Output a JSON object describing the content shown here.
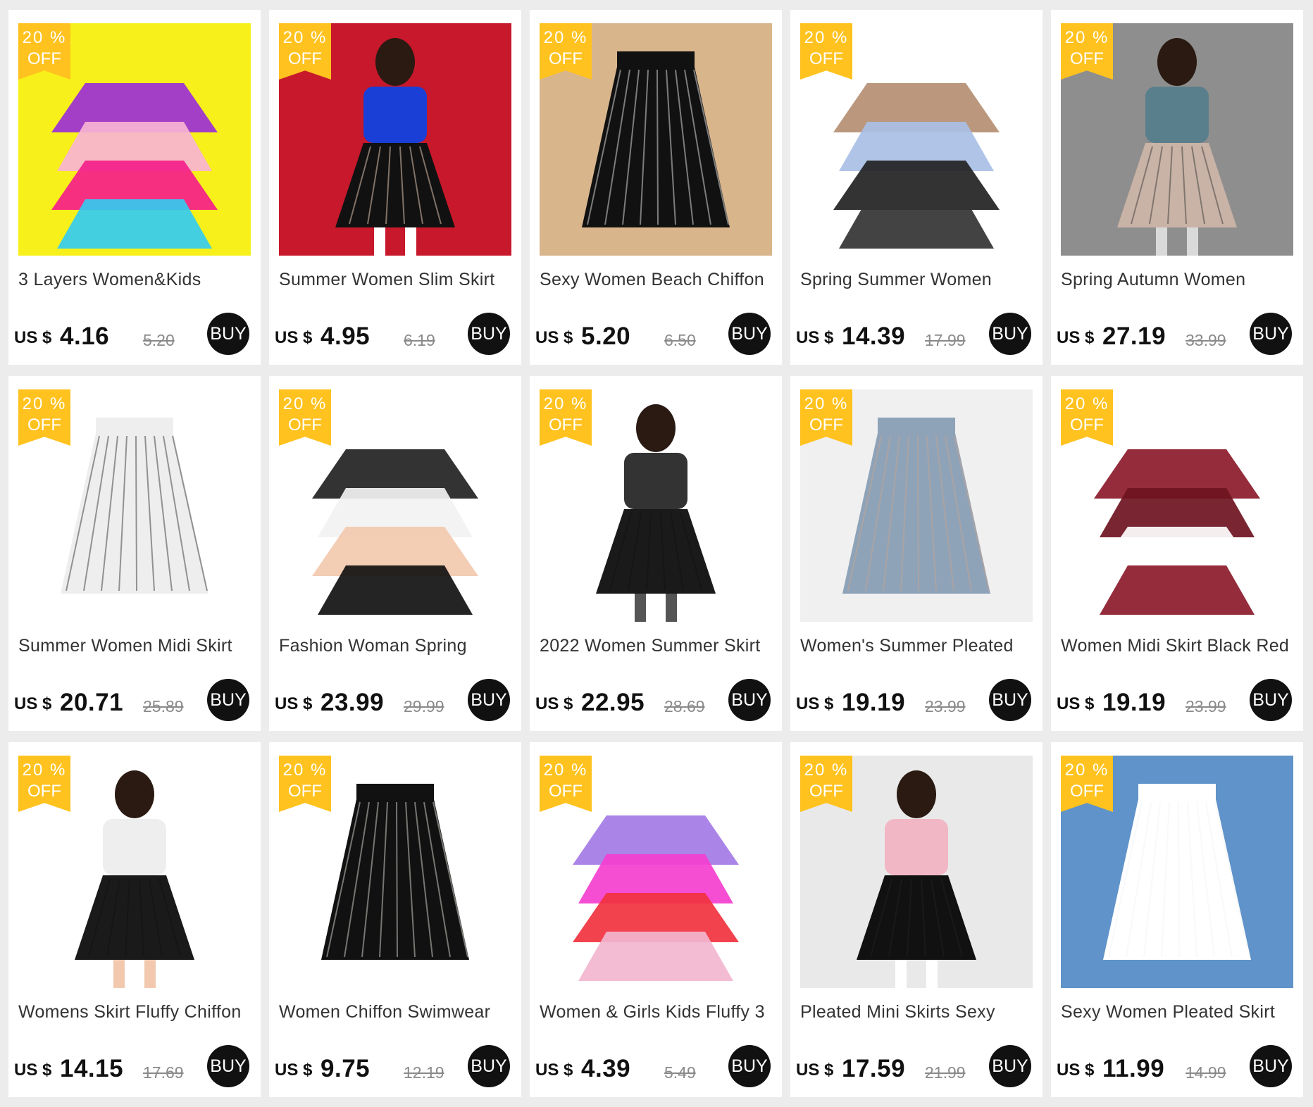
{
  "theme": {
    "badge_color": "#ffc21f",
    "buy_button_color": "#111111",
    "page_background": "#ececec"
  },
  "products": [
    {
      "badge": {
        "percent": "20 %",
        "off": "OFF"
      },
      "image_icon": "tutu-skirt-stack-image",
      "title": "3 Layers Women&Kids",
      "currency": "US $",
      "price": "4.16",
      "old_price": "5.20",
      "buy_label": "BUY",
      "palette": [
        "#f7f01a",
        "#9b2fd6",
        "#f7b3d3",
        "#f51e8a",
        "#33ccf0"
      ]
    },
    {
      "badge": {
        "percent": "20 %",
        "off": "OFF"
      },
      "image_icon": "pencil-skirt-models-image",
      "title": "Summer Women Slim Skirt",
      "currency": "US $",
      "price": "4.95",
      "old_price": "6.19",
      "buy_label": "BUY",
      "palette": [
        "#c8182b",
        "#111111",
        "#1a3fd6",
        "#ffffff",
        "#f1d2bd"
      ]
    },
    {
      "badge": {
        "percent": "20 %",
        "off": "OFF"
      },
      "image_icon": "beach-wrap-skirt-image",
      "title": "Sexy Women Beach Chiffon",
      "currency": "US $",
      "price": "5.20",
      "old_price": "6.50",
      "buy_label": "BUY",
      "palette": [
        "#d9b58c",
        "#111111",
        "#ffffff",
        "#e8e21a",
        "#7a2fbf"
      ]
    },
    {
      "badge": {
        "percent": "20 %",
        "off": "OFF"
      },
      "image_icon": "floral-maxi-skirt-image",
      "title": "Spring Summer Women",
      "currency": "US $",
      "price": "14.39",
      "old_price": "17.99",
      "buy_label": "BUY",
      "palette": [
        "#ffffff",
        "#b58f72",
        "#a9bfe6",
        "#222222",
        "#333333"
      ]
    },
    {
      "badge": {
        "percent": "20 %",
        "off": "OFF"
      },
      "image_icon": "pleated-knit-skirt-image",
      "title": "Spring Autumn Women",
      "currency": "US $",
      "price": "27.19",
      "old_price": "33.99",
      "buy_label": "BUY",
      "palette": [
        "#8e8e8e",
        "#c9b3a6",
        "#5a7f8c",
        "#d9d9d9",
        "#3a3a3a"
      ]
    },
    {
      "badge": {
        "percent": "20 %",
        "off": "OFF"
      },
      "image_icon": "polka-dot-midi-skirt-image",
      "title": "Summer Women Midi Skirt",
      "currency": "US $",
      "price": "20.71",
      "old_price": "25.89",
      "buy_label": "BUY",
      "palette": [
        "#ffffff",
        "#eeeeee",
        "#222222",
        "#f2c9ae",
        "#111111"
      ]
    },
    {
      "badge": {
        "percent": "20 %",
        "off": "OFF"
      },
      "image_icon": "floral-aline-skirt-image",
      "title": "Fashion Woman Spring",
      "currency": "US $",
      "price": "23.99",
      "old_price": "29.99",
      "buy_label": "BUY",
      "palette": [
        "#ffffff",
        "#222222",
        "#f2f2f2",
        "#f2c9ae",
        "#111111"
      ]
    },
    {
      "badge": {
        "percent": "20 %",
        "off": "OFF"
      },
      "image_icon": "black-mesh-skirt-image",
      "title": "2022 Women Summer Skirt",
      "currency": "US $",
      "price": "22.95",
      "old_price": "28.69",
      "buy_label": "BUY",
      "palette": [
        "#ffffff",
        "#1a1a1a",
        "#333333",
        "#555555",
        "#111111"
      ]
    },
    {
      "badge": {
        "percent": "20 %",
        "off": "OFF"
      },
      "image_icon": "pleated-tulle-skirts-rack-image",
      "title": "Women's Summer Pleated",
      "currency": "US $",
      "price": "19.19",
      "old_price": "23.99",
      "buy_label": "BUY",
      "palette": [
        "#f0f0f0",
        "#8fa3b8",
        "#c9a58c",
        "#222222",
        "#e8d8c8"
      ]
    },
    {
      "badge": {
        "percent": "20 %",
        "off": "OFF"
      },
      "image_icon": "burgundy-pleated-skirt-image",
      "title": "Women Midi Skirt Black Red",
      "currency": "US $",
      "price": "19.19",
      "old_price": "23.99",
      "buy_label": "BUY",
      "palette": [
        "#ffffff",
        "#8b1a2b",
        "#6e1421",
        "#ffffff",
        "#8b1a2b"
      ]
    },
    {
      "badge": {
        "percent": "20 %",
        "off": "OFF"
      },
      "image_icon": "black-ruffle-skirt-image",
      "title": "Womens Skirt Fluffy Chiffon",
      "currency": "US $",
      "price": "14.15",
      "old_price": "17.69",
      "buy_label": "BUY",
      "palette": [
        "#ffffff",
        "#1a1a1a",
        "#eeeeee",
        "#f2c9ae",
        "#111111"
      ]
    },
    {
      "badge": {
        "percent": "20 %",
        "off": "OFF"
      },
      "image_icon": "chiffon-swimwear-wraps-image",
      "title": "Women Chiffon Swimwear",
      "currency": "US $",
      "price": "9.75",
      "old_price": "12.19",
      "buy_label": "BUY",
      "palette": [
        "#ffffff",
        "#111111",
        "#f1efe6",
        "#1f9cd9",
        "#2fc24a"
      ]
    },
    {
      "badge": {
        "percent": "20 %",
        "off": "OFF"
      },
      "image_icon": "kids-tutu-colors-image",
      "title": "Women & Girls Kids Fluffy 3",
      "currency": "US $",
      "price": "4.39",
      "old_price": "5.49",
      "buy_label": "BUY",
      "palette": [
        "#ffffff",
        "#a47ae6",
        "#f43fcf",
        "#f1323e",
        "#f2b6cf"
      ]
    },
    {
      "badge": {
        "percent": "20 %",
        "off": "OFF"
      },
      "image_icon": "heart-print-skirt-image",
      "title": "Pleated Mini Skirts Sexy",
      "currency": "US $",
      "price": "17.59",
      "old_price": "21.99",
      "buy_label": "BUY",
      "palette": [
        "#e9e9e9",
        "#111111",
        "#f1b7c4",
        "#ffffff",
        "#222222"
      ]
    },
    {
      "badge": {
        "percent": "20 %",
        "off": "OFF"
      },
      "image_icon": "white-pleated-skirt-image",
      "title": "Sexy Women Pleated Skirt",
      "currency": "US $",
      "price": "11.99",
      "old_price": "14.99",
      "buy_label": "BUY",
      "palette": [
        "#5f93c9",
        "#ffffff",
        "#f2f2f2",
        "#111111",
        "#3a6fa8"
      ]
    }
  ]
}
